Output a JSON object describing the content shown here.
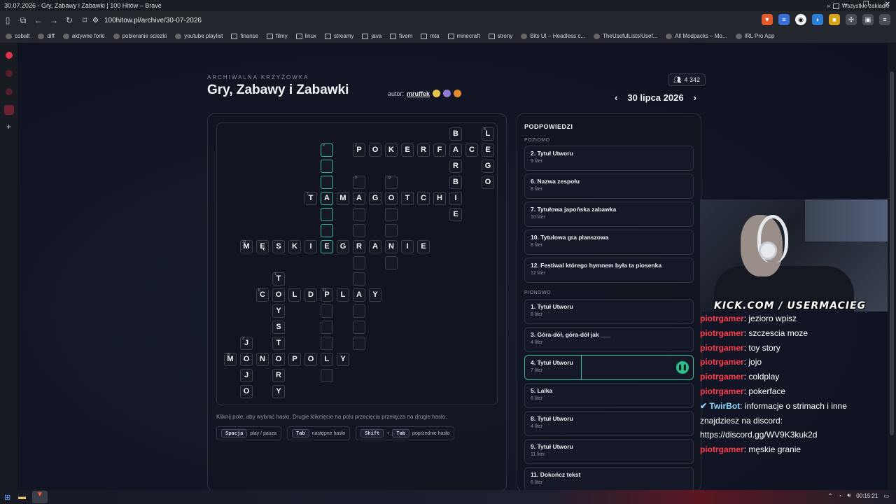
{
  "window": {
    "title": "30.07.2026 - Gry, Zabawy i Zabawki | 100 Hitów – Brave"
  },
  "browser": {
    "url": "100hitow.pl/archive/30-07-2026"
  },
  "bookmarks": [
    "cobalt",
    "diff",
    "aktywne forki",
    "pobieranie sciezki",
    "youtube playlist",
    "finanse",
    "filmy",
    "linux",
    "streamy",
    "java",
    "fivem",
    "mta",
    "minecraft",
    "strony",
    "Bits UI – Headless c...",
    "TheUsefulLists/Usef...",
    "All Modpacks – Mo...",
    "IRL Pro App"
  ],
  "bookmarks_more": "»",
  "bookmarks_all": "Wszystkie zakładki",
  "page": {
    "kicker": "ARCHIWALNA KRZYŻÓWKA",
    "title": "Gry, Zabawy i Zabawki",
    "author_label": "autor:",
    "author": "mruffek",
    "players": "4 342",
    "date": "30 lipca 2026",
    "prev": "‹",
    "next": "›"
  },
  "grid": {
    "cells": [
      {
        "r": 0,
        "c": 14,
        "l": "B"
      },
      {
        "r": 0,
        "c": 16,
        "l": "L",
        "n": "8"
      },
      {
        "r": 1,
        "c": 6,
        "l": "",
        "n": "4",
        "sel": true
      },
      {
        "r": 1,
        "c": 8,
        "l": "P",
        "n": "2"
      },
      {
        "r": 1,
        "c": 9,
        "l": "O"
      },
      {
        "r": 1,
        "c": 10,
        "l": "K"
      },
      {
        "r": 1,
        "c": 11,
        "l": "E"
      },
      {
        "r": 1,
        "c": 12,
        "l": "R"
      },
      {
        "r": 1,
        "c": 13,
        "l": "F"
      },
      {
        "r": 1,
        "c": 14,
        "l": "A"
      },
      {
        "r": 1,
        "c": 15,
        "l": "C"
      },
      {
        "r": 1,
        "c": 16,
        "l": "E"
      },
      {
        "r": 2,
        "c": 6,
        "l": "",
        "sel": true
      },
      {
        "r": 2,
        "c": 14,
        "l": "R"
      },
      {
        "r": 2,
        "c": 16,
        "l": "G"
      },
      {
        "r": 3,
        "c": 6,
        "l": "",
        "sel": true
      },
      {
        "r": 3,
        "c": 8,
        "l": "",
        "n": "9"
      },
      {
        "r": 3,
        "c": 10,
        "l": "",
        "n": "13"
      },
      {
        "r": 3,
        "c": 14,
        "l": "B"
      },
      {
        "r": 3,
        "c": 16,
        "l": "O"
      },
      {
        "r": 4,
        "c": 5,
        "l": "T",
        "n": "7"
      },
      {
        "r": 4,
        "c": 6,
        "l": "A",
        "sel": true
      },
      {
        "r": 4,
        "c": 7,
        "l": "M"
      },
      {
        "r": 4,
        "c": 8,
        "l": "A"
      },
      {
        "r": 4,
        "c": 9,
        "l": "G"
      },
      {
        "r": 4,
        "c": 10,
        "l": "O"
      },
      {
        "r": 4,
        "c": 11,
        "l": "T"
      },
      {
        "r": 4,
        "c": 12,
        "l": "C"
      },
      {
        "r": 4,
        "c": 13,
        "l": "H"
      },
      {
        "r": 4,
        "c": 14,
        "l": "I"
      },
      {
        "r": 5,
        "c": 6,
        "l": "",
        "sel": true
      },
      {
        "r": 5,
        "c": 8,
        "l": ""
      },
      {
        "r": 5,
        "c": 10,
        "l": ""
      },
      {
        "r": 5,
        "c": 14,
        "l": "E"
      },
      {
        "r": 6,
        "c": 6,
        "l": "",
        "sel": true
      },
      {
        "r": 6,
        "c": 8,
        "l": ""
      },
      {
        "r": 6,
        "c": 10,
        "l": ""
      },
      {
        "r": 7,
        "c": 1,
        "l": "M",
        "n": "12"
      },
      {
        "r": 7,
        "c": 2,
        "l": "Ę"
      },
      {
        "r": 7,
        "c": 3,
        "l": "S"
      },
      {
        "r": 7,
        "c": 4,
        "l": "K"
      },
      {
        "r": 7,
        "c": 5,
        "l": "I"
      },
      {
        "r": 7,
        "c": 6,
        "l": "E",
        "sel": true
      },
      {
        "r": 7,
        "c": 7,
        "l": "G"
      },
      {
        "r": 7,
        "c": 8,
        "l": "R"
      },
      {
        "r": 7,
        "c": 9,
        "l": "A"
      },
      {
        "r": 7,
        "c": 10,
        "l": "N"
      },
      {
        "r": 7,
        "c": 11,
        "l": "I"
      },
      {
        "r": 7,
        "c": 12,
        "l": "E"
      },
      {
        "r": 8,
        "c": 8,
        "l": ""
      },
      {
        "r": 8,
        "c": 10,
        "l": ""
      },
      {
        "r": 9,
        "c": 3,
        "l": "T",
        "n": "1"
      },
      {
        "r": 9,
        "c": 8,
        "l": ""
      },
      {
        "r": 10,
        "c": 2,
        "l": "C",
        "n": "6"
      },
      {
        "r": 10,
        "c": 3,
        "l": "O"
      },
      {
        "r": 10,
        "c": 4,
        "l": "L"
      },
      {
        "r": 10,
        "c": 5,
        "l": "D"
      },
      {
        "r": 10,
        "c": 6,
        "l": "P",
        "n": "11"
      },
      {
        "r": 10,
        "c": 7,
        "l": "L"
      },
      {
        "r": 10,
        "c": 8,
        "l": "A"
      },
      {
        "r": 10,
        "c": 9,
        "l": "Y"
      },
      {
        "r": 11,
        "c": 3,
        "l": "Y"
      },
      {
        "r": 11,
        "c": 6,
        "l": ""
      },
      {
        "r": 11,
        "c": 8,
        "l": ""
      },
      {
        "r": 12,
        "c": 3,
        "l": "S"
      },
      {
        "r": 12,
        "c": 6,
        "l": ""
      },
      {
        "r": 12,
        "c": 8,
        "l": ""
      },
      {
        "r": 13,
        "c": 1,
        "l": "J",
        "n": "3"
      },
      {
        "r": 13,
        "c": 3,
        "l": "T"
      },
      {
        "r": 13,
        "c": 6,
        "l": ""
      },
      {
        "r": 13,
        "c": 8,
        "l": ""
      },
      {
        "r": 14,
        "c": 0,
        "l": "M",
        "n": "10"
      },
      {
        "r": 14,
        "c": 1,
        "l": "O"
      },
      {
        "r": 14,
        "c": 2,
        "l": "N"
      },
      {
        "r": 14,
        "c": 3,
        "l": "O"
      },
      {
        "r": 14,
        "c": 4,
        "l": "P"
      },
      {
        "r": 14,
        "c": 5,
        "l": "O"
      },
      {
        "r": 14,
        "c": 6,
        "l": "L"
      },
      {
        "r": 14,
        "c": 7,
        "l": "Y"
      },
      {
        "r": 15,
        "c": 1,
        "l": "J"
      },
      {
        "r": 15,
        "c": 3,
        "l": "R"
      },
      {
        "r": 15,
        "c": 6,
        "l": ""
      },
      {
        "r": 16,
        "c": 1,
        "l": "O"
      },
      {
        "r": 16,
        "c": 3,
        "l": "Y"
      }
    ]
  },
  "help": {
    "hint": "Kliknij pole, aby wybrać hasło. Drugie kliknięcie na polu przecięcia przełącza na drugie hasło.",
    "keys": [
      {
        "k": [
          "Spacja"
        ],
        "d": "play / pauza"
      },
      {
        "k": [
          "Tab"
        ],
        "d": "następne hasło"
      },
      {
        "k": [
          "Shift",
          "Tab"
        ],
        "d": "poprzednie hasło",
        "plus": "+"
      }
    ]
  },
  "clues": {
    "heading": "PODPOWIEDZI",
    "across_label": "POZIOMO",
    "down_label": "PIONOWO",
    "across": [
      {
        "t": "2. Tytuł Utworu",
        "l": "9 liter"
      },
      {
        "t": "6. Nazwa zespołu",
        "l": "8 liter"
      },
      {
        "t": "7. Tytułowa japońska zabawka",
        "l": "10 liter"
      },
      {
        "t": "10. Tytułowa gra planszowa",
        "l": "8 liter"
      },
      {
        "t": "12. Festiwal którego hymnem była ta piosenka",
        "l": "12 liter"
      }
    ],
    "down": [
      {
        "t": "1. Tytuł Utworu",
        "l": "8 liter"
      },
      {
        "t": "3. Góra-dół, góra-dół jak ___",
        "l": "4 liter"
      },
      {
        "t": "4. Tytuł Utworu",
        "l": "7 liter",
        "active": true
      },
      {
        "t": "5. Lalka",
        "l": "6 liter"
      },
      {
        "t": "8. Tytuł Utworu",
        "l": "4 liter"
      },
      {
        "t": "9. Tytuł Utworu",
        "l": "11 liter"
      },
      {
        "t": "11. Dokończ tekst",
        "l": "6 liter"
      }
    ]
  },
  "stream": {
    "overlay": "KICK.COM / USERMACIEG",
    "chat": [
      {
        "u": "piotrgamer",
        "m": ": jezioro wpisz"
      },
      {
        "u": "piotrgamer",
        "m": ": szczescia moze"
      },
      {
        "u": "piotrgamer",
        "m": ": toy story"
      },
      {
        "u": "piotrgamer",
        "m": ": jojo"
      },
      {
        "u": "piotrgamer",
        "m": ": coldplay"
      },
      {
        "u": "piotrgamer",
        "m": ": pokerface"
      },
      {
        "u": "TwirBot",
        "m": ": informacje o strimach i inne znajdziesz na discord: https://discord.gg/WV9K3kuk2d",
        "bot": true
      },
      {
        "u": "piotrgamer",
        "m": ": męskie granie"
      }
    ]
  },
  "taskbar": {
    "time": "00:15:21"
  },
  "colors": {
    "accent": "#3fb8a3",
    "chat_user": "#ff3d4f",
    "pause": "#2bbf8e"
  }
}
